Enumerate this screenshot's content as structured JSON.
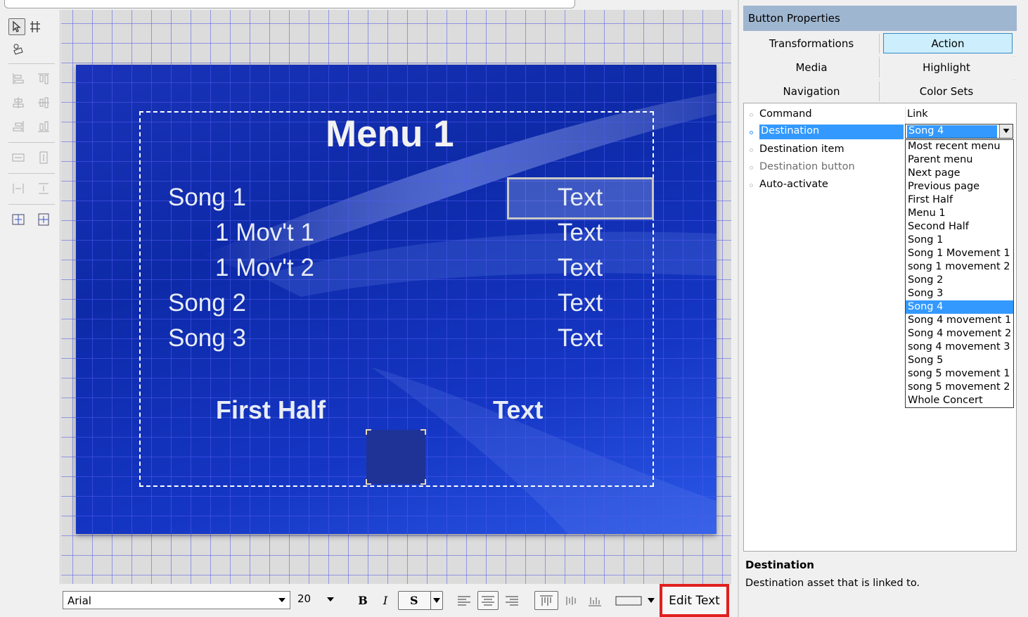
{
  "slide": {
    "title": "Menu 1",
    "items": [
      {
        "label": "Song 1",
        "value": "Text"
      },
      {
        "label": "1 Mov't 1",
        "value": "Text"
      },
      {
        "label": "1 Mov't 2",
        "value": "Text"
      },
      {
        "label": "Song 2",
        "value": "Text"
      },
      {
        "label": "Song 3",
        "value": "Text"
      }
    ],
    "footer_label": "First Half",
    "footer_value": "Text"
  },
  "text_toolbar": {
    "font": "Arial",
    "size": "20",
    "bold_label": "B",
    "italic_label": "I",
    "shadow_label": "S",
    "edit_text_label": "Edit Text"
  },
  "panel": {
    "title": "Button Properties",
    "tabs": [
      {
        "label": "Transformations",
        "selected": false
      },
      {
        "label": "Action",
        "selected": true
      },
      {
        "label": "Media",
        "selected": false
      },
      {
        "label": "Highlight",
        "selected": false
      },
      {
        "label": "Navigation",
        "selected": false
      },
      {
        "label": "Color Sets",
        "selected": false
      }
    ],
    "properties": [
      {
        "name": "Command",
        "value": "Link"
      },
      {
        "name": "Destination",
        "value": "Song 4"
      },
      {
        "name": "Destination item",
        "value": ""
      },
      {
        "name": "Destination button",
        "value": ""
      },
      {
        "name": "Auto-activate",
        "value": ""
      }
    ],
    "destination_options": [
      "Most recent menu",
      "Parent menu",
      "Next page",
      "Previous page",
      "First Half",
      "Menu 1",
      "Second Half",
      "Song 1",
      "Song 1 Movement 1",
      "song 1 movement 2",
      "Song 2",
      "Song 3",
      "Song 4",
      "Song 4 movement 1",
      "Song 4 movement 2",
      "song 4 movement 3",
      "Song 5",
      "song 5 movement 1",
      "song 5 movement 2",
      "Whole Concert"
    ],
    "selected_destination": "Song 4",
    "description_title": "Destination",
    "description_text": "Destination asset that is linked to."
  },
  "colors": {
    "slide_blue": "#0d2aa8",
    "selection_blue": "#3399ff",
    "panel_header": "#9fb6d0",
    "edit_text_outline": "#e0201e"
  }
}
